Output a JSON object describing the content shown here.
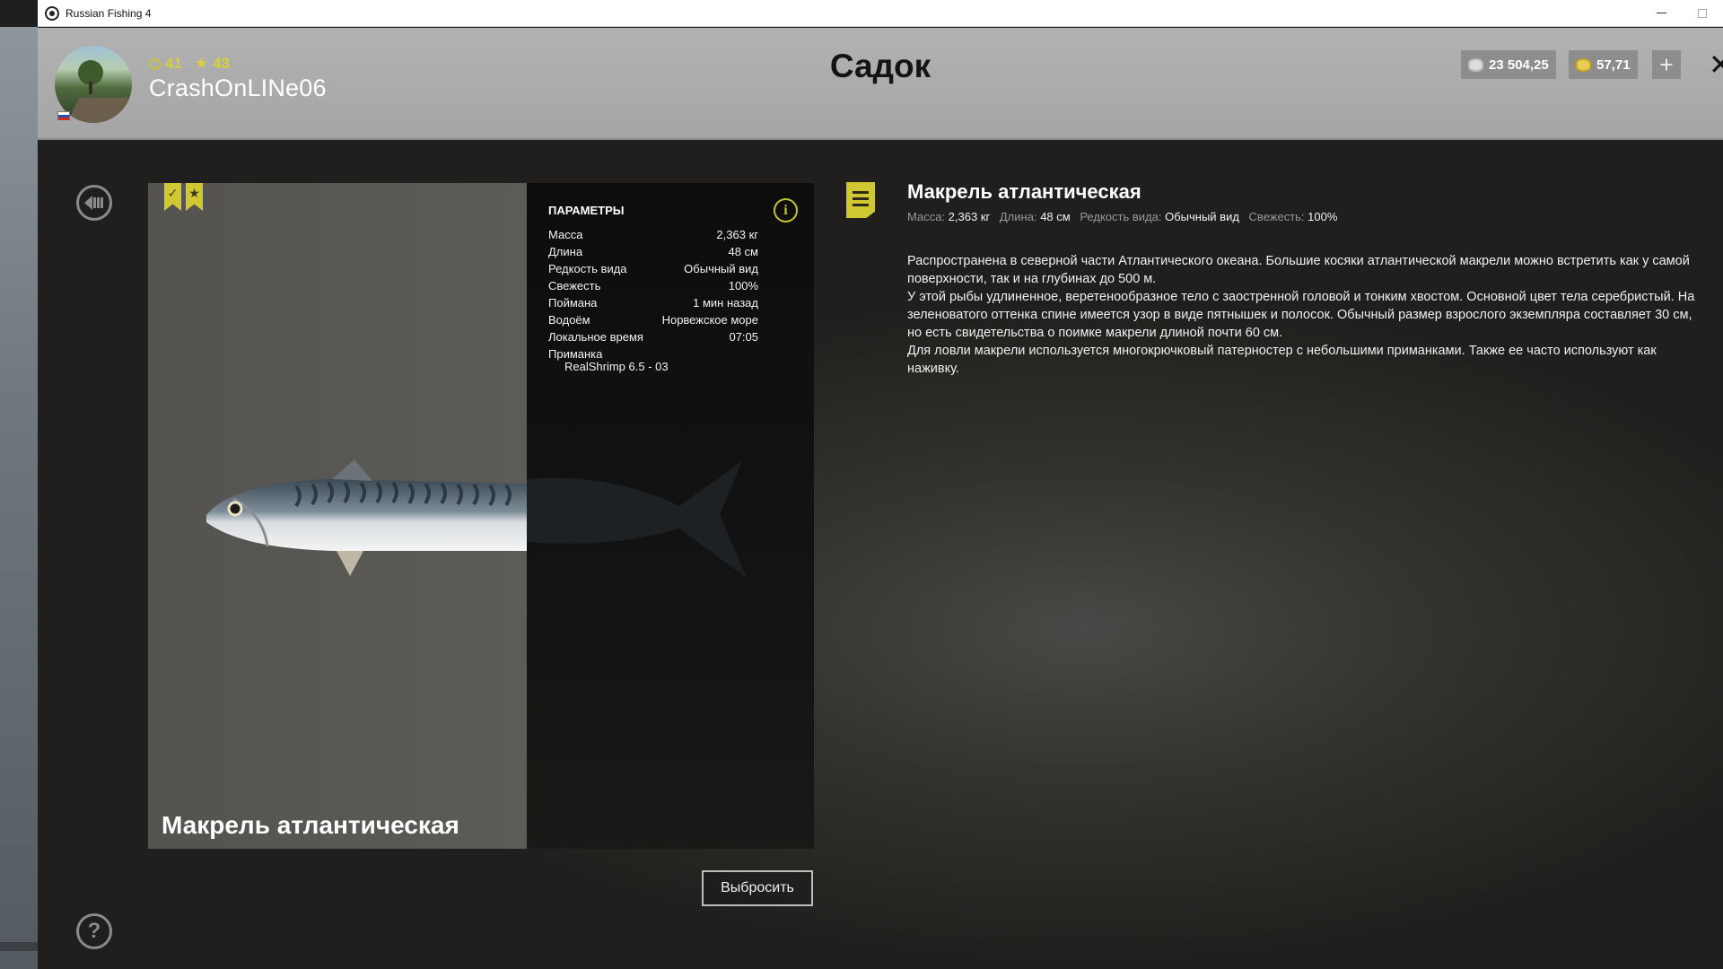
{
  "window": {
    "title": "Russian Fishing 4",
    "controls": [
      "minimize",
      "maximize"
    ]
  },
  "header": {
    "page_title": "Садок",
    "player": {
      "name": "CrashOnLINe06",
      "level": "41",
      "rank": "43",
      "flag": "russia-flag"
    },
    "currency": {
      "silver": "23 504,25",
      "gold": "57,71"
    },
    "add_label": "+"
  },
  "fish_card": {
    "name": "Макрель атлантическая",
    "bookmarks": [
      "check-bookmark-icon",
      "star-bookmark-icon"
    ]
  },
  "params": {
    "heading": "Параметры",
    "rows": [
      {
        "label": "Масса",
        "value": "2,363 кг"
      },
      {
        "label": "Длина",
        "value": "48 см"
      },
      {
        "label": "Редкость вида",
        "value": "Обычный вид"
      },
      {
        "label": "Свежесть",
        "value": "100%"
      },
      {
        "label": "Поймана",
        "value": "1 мин назад"
      },
      {
        "label": "Водоём",
        "value": "Норвежское море"
      },
      {
        "label": "Локальное время",
        "value": "07:05"
      }
    ],
    "lure_label": "Приманка",
    "lure_value": "RealShrimp 6.5 - 03"
  },
  "release_button": "Выбросить",
  "description": {
    "title": "Макрель атлантическая",
    "meta": [
      {
        "label": "Масса:",
        "value": "2,363 кг"
      },
      {
        "label": "Длина:",
        "value": "48 см"
      },
      {
        "label": "Редкость вида:",
        "value": "Обычный вид"
      },
      {
        "label": "Свежесть:",
        "value": "100%"
      }
    ],
    "paragraphs": [
      "Распространена в северной части Атлантического океана. Большие косяки атлантической макрели можно встретить как у самой поверхности, так и на глубинах до 500 м.",
      "У этой рыбы удлиненное, веретенообразное тело с заостренной головой и тонким хвостом. Основной цвет тела серебристый. На зеленоватого оттенка спине имеется узор в виде пятнышек и полосок. Обычный размер взрослого экземпляра составляет 30 см, но есть свидетельства о поимке макрели длиной почти 60 см.",
      "Для ловли макрели используется многокрючковый патерностер с небольшими приманками. Также ее часто используют как наживку."
    ]
  },
  "colors": {
    "accent": "#cfc832",
    "header_bg": "#a8a8a8",
    "panel_dark": "#111111"
  },
  "icons": {
    "back": "back-icon",
    "help": "help-icon",
    "info": "info-icon",
    "description": "description-icon",
    "close": "close-icon"
  }
}
